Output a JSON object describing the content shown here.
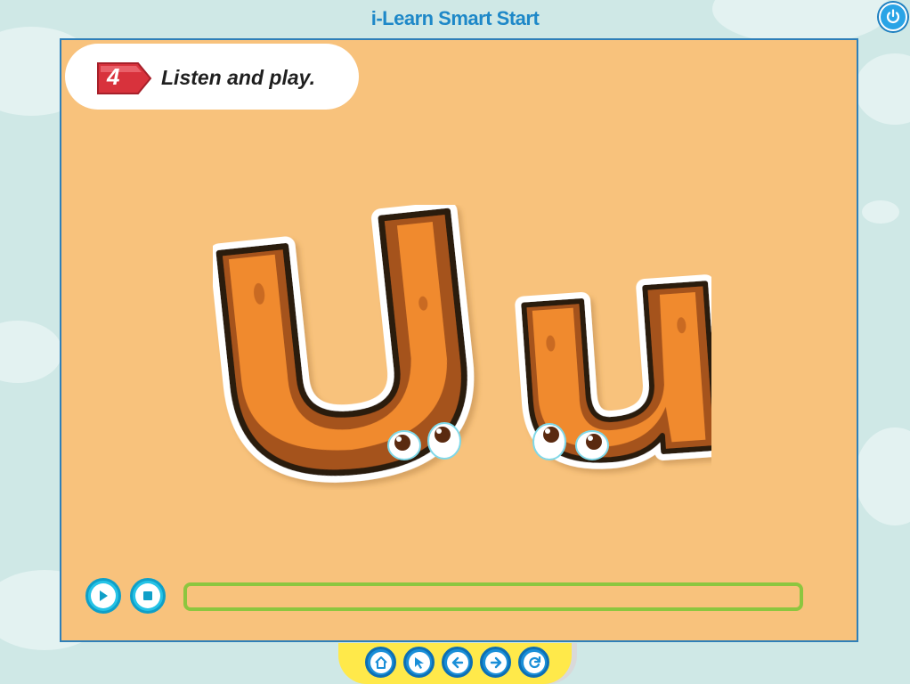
{
  "app": {
    "title": "i-Learn Smart Start"
  },
  "activity": {
    "number": "4",
    "instruction": "Listen and play."
  },
  "content": {
    "uppercase_letter": "U",
    "lowercase_letter": "u"
  },
  "player": {
    "play_icon": "play-icon",
    "stop_icon": "stop-icon",
    "progress": 0
  },
  "navigation": {
    "buttons": [
      "home-icon",
      "cursor-icon",
      "back-arrow-icon",
      "next-arrow-icon",
      "refresh-icon"
    ]
  },
  "colors": {
    "stage_bg": "#f8c27c",
    "letter_fill": "#f08a2e",
    "accent_blue": "#1e88c8",
    "progress_green": "#8cc63f",
    "badge_red": "#d8323c"
  }
}
